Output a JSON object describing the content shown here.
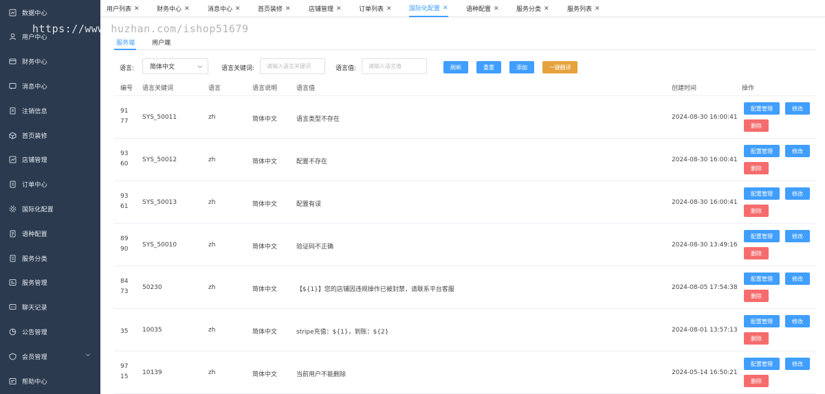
{
  "sidebar": {
    "items": [
      {
        "label": "数据中心",
        "icon": "dashboard-icon"
      },
      {
        "label": "用户中心",
        "icon": "user-icon"
      },
      {
        "label": "财务中心",
        "icon": "finance-icon"
      },
      {
        "label": "消息中心",
        "icon": "message-icon"
      },
      {
        "label": "注销信息",
        "icon": "document-icon"
      },
      {
        "label": "首页装修",
        "icon": "cube-icon"
      },
      {
        "label": "店铺管理",
        "icon": "chart-icon"
      },
      {
        "label": "订单中心",
        "icon": "order-icon"
      },
      {
        "label": "国际化配置",
        "icon": "settings-icon"
      },
      {
        "label": "语种配置",
        "icon": "list-icon"
      },
      {
        "label": "服务分类",
        "icon": "category-icon"
      },
      {
        "label": "服务管理",
        "icon": "service-icon"
      },
      {
        "label": "聊天记录",
        "icon": "chat-icon"
      },
      {
        "label": "公告管理",
        "icon": "announcement-icon"
      },
      {
        "label": "会员管理",
        "icon": "member-icon"
      },
      {
        "label": "帮助中心",
        "icon": "help-icon"
      }
    ]
  },
  "tabs": [
    {
      "label": "用户列表"
    },
    {
      "label": "财务中心"
    },
    {
      "label": "消息中心"
    },
    {
      "label": "首页装修"
    },
    {
      "label": "店铺管理"
    },
    {
      "label": "订单列表"
    },
    {
      "label": "国际化配置"
    },
    {
      "label": "语种配置"
    },
    {
      "label": "服务分类"
    },
    {
      "label": "服务列表"
    }
  ],
  "watermark": {
    "part1": "https://www.",
    "part2": "huzhan",
    "part3": ".com/ishop51679"
  },
  "subtabs": {
    "service": "服务端",
    "user": "用户端"
  },
  "filters": {
    "language_label": "语言:",
    "language_value": "简体中文",
    "keyword_label": "语言关键词:",
    "keyword_placeholder": "请输入语言关键词",
    "value_label": "语言值:",
    "value_placeholder": "请输入语言值",
    "refresh": "刷新",
    "reset": "重置",
    "add": "添加",
    "translate": "一键翻译"
  },
  "table": {
    "headers": {
      "id": "编号",
      "keyword": "语言关键词",
      "language": "语言",
      "desc": "语言说明",
      "value": "语言值",
      "created": "创建时间",
      "actions": "操作"
    },
    "action_labels": {
      "config": "配置管理",
      "edit": "修改",
      "delete": "删除"
    },
    "rows": [
      {
        "id": "9177",
        "keyword": "SYS_50011",
        "language": "zh",
        "desc": "简体中文",
        "value": "语言类型不存在",
        "created": "2024-08-30 16:00:41"
      },
      {
        "id": "9360",
        "keyword": "SYS_50012",
        "language": "zh",
        "desc": "简体中文",
        "value": "配置不存在",
        "created": "2024-08-30 16:00:41"
      },
      {
        "id": "9361",
        "keyword": "SYS_50013",
        "language": "zh",
        "desc": "简体中文",
        "value": "配置有误",
        "created": "2024-08-30 16:00:41"
      },
      {
        "id": "8990",
        "keyword": "SYS_50010",
        "language": "zh",
        "desc": "简体中文",
        "value": "验证码不正确",
        "created": "2024-08-30 13:49:16"
      },
      {
        "id": "8473",
        "keyword": "50230",
        "language": "zh",
        "desc": "简体中文",
        "value": "【${1}】您的店铺因违规操作已被封禁，请联系平台客服",
        "created": "2024-08-05 17:54:38"
      },
      {
        "id": "35",
        "keyword": "10035",
        "language": "zh",
        "desc": "简体中文",
        "value": "stripe充值：${1}，到账：${2}",
        "created": "2024-08-01 13:57:13"
      },
      {
        "id": "9715",
        "keyword": "10139",
        "language": "zh",
        "desc": "简体中文",
        "value": "当前用户不能删除",
        "created": "2024-05-14 16:50:21"
      }
    ]
  },
  "colors": {
    "sidebar_bg": "#2b3a4f",
    "primary": "#409eff",
    "danger": "#f56c6c",
    "warning": "#e6a23c"
  }
}
